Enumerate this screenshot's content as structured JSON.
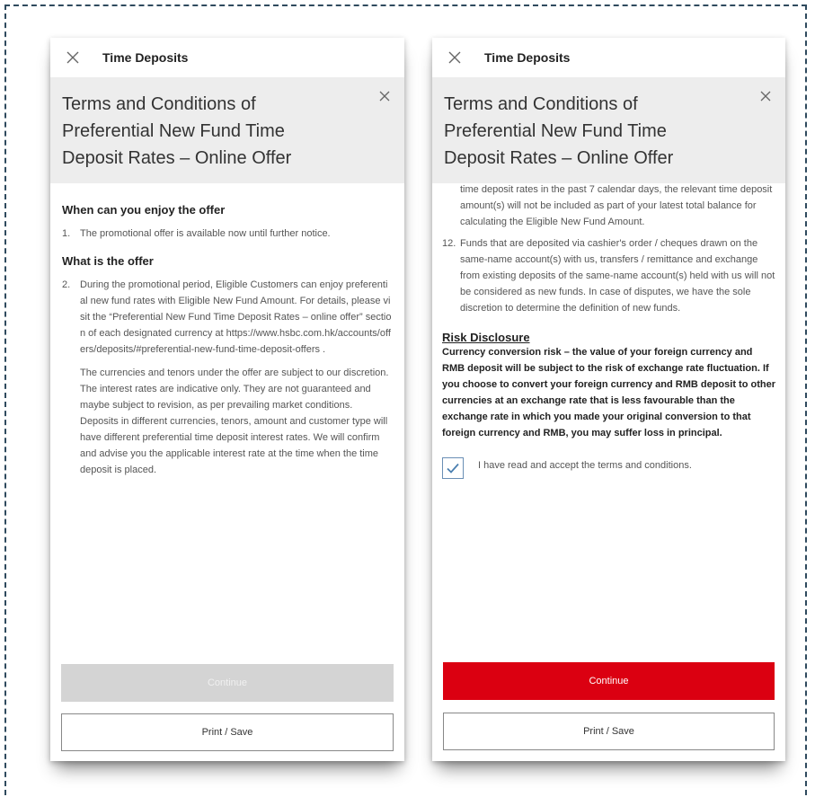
{
  "left": {
    "topbar_title": "Time Deposits",
    "header_title": "Terms and Conditions of Preferential New Fund Time Deposit Rates – Online Offer",
    "section1_title": "When can you enjoy the offer",
    "item1_num": "1.",
    "item1_text": "The promotional offer is available now until further notice.",
    "section2_title": "What is the offer",
    "item2_num": "2.",
    "item2_text": "During the promotional period, Eligible Customers can enjoy preferential new fund rates with Eligible New Fund Amount. For details, please visit the “Preferential New Fund Time Deposit Rates – online offer” section of each designated currency at https://www.hsbc.com.hk/accounts/offers/deposits/#preferential-new-fund-time-deposit-offers .",
    "item2_para": "The currencies and tenors under the offer are subject to our discretion. The interest rates are indicative only. They are not guaranteed and maybe subject to revision, as per prevailing market conditions. Deposits in different currencies, tenors, amount and customer type will have different preferential time deposit interest rates. We will confirm and advise you the applicable interest rate at the time when the time deposit is placed.",
    "continue_label": "Continue",
    "print_label": "Print / Save"
  },
  "right": {
    "topbar_title": "Time Deposits",
    "header_title": "Terms and Conditions of Preferential New Fund Time Deposit Rates – Online Offer",
    "item11_cont": "time deposit rates in the past 7 calendar days, the relevant time deposit amount(s) will not be included as part of your latest total balance for calculating the Eligible New Fund Amount.",
    "item12_num": "12.",
    "item12_text": "Funds that are deposited via cashier's order / cheques drawn on the same-name account(s) with us, transfers / remittance and exchange from existing deposits of the same-name account(s) held with us will not be considered as new funds. In case of disputes, we have the sole discretion to determine the definition of new funds.",
    "risk_title": "Risk Disclosure",
    "risk_text": "Currency conversion risk – the value of your foreign currency and RMB deposit will be subject to the risk of exchange rate fluctuation. If you choose to convert your foreign currency and RMB deposit to other currencies at an exchange rate that is less favourable than the exchange rate in which you made your original conversion to that foreign currency and RMB, you may suffer loss in principal.",
    "accept_text": "I have read and accept the terms and conditions.",
    "accept_checked": true,
    "continue_label": "Continue",
    "print_label": "Print / Save"
  },
  "colors": {
    "brand_red": "#db0011",
    "disabled_gray": "#d4d4d4",
    "header_bg": "#ededed",
    "checkbox_blue": "#6a8fb5"
  },
  "icons": {
    "close": "close-icon",
    "check": "checkmark-icon"
  }
}
